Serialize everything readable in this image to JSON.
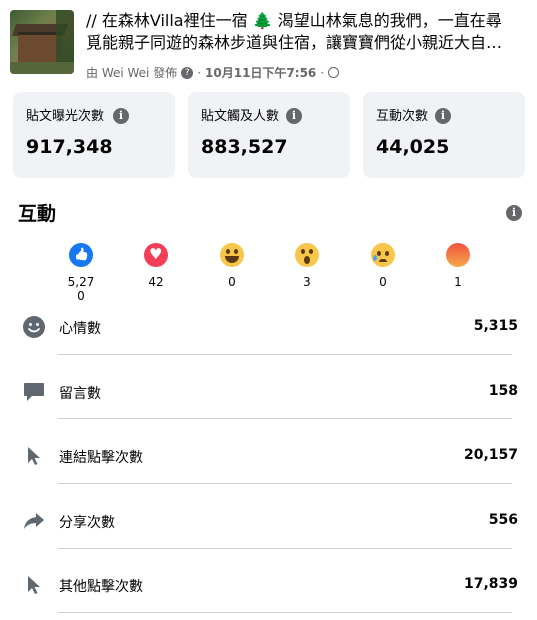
{
  "post": {
    "line1": "// 在森林Villa裡住一宿 🌲 渴望山林氣息的我們，一直在尋",
    "line2": "覓能親子同遊的森林步道與住宿，讓寶寶們從小親近大自…",
    "author_prefix": "由 Wei Wei 發佈",
    "date": "10月11日下午7:56",
    "separator": "·"
  },
  "stats": [
    {
      "label": "貼文曝光次數",
      "value": "917,348"
    },
    {
      "label": "貼文觸及人數",
      "value": "883,527"
    },
    {
      "label": "互動次數",
      "value": "44,025"
    }
  ],
  "engagement": {
    "title": "互動",
    "reactions": [
      {
        "icon": "like-icon",
        "count": "5,270"
      },
      {
        "icon": "love-icon",
        "count": "42"
      },
      {
        "icon": "haha-icon",
        "count": "0"
      },
      {
        "icon": "wow-icon",
        "count": "3"
      },
      {
        "icon": "sad-icon",
        "count": "0"
      },
      {
        "icon": "angry-icon",
        "count": "1"
      }
    ],
    "rows": [
      {
        "icon": "smiley-icon",
        "label": "心情數",
        "value": "5,315"
      },
      {
        "icon": "comment-icon",
        "label": "留言數",
        "value": "158"
      },
      {
        "icon": "cursor-icon",
        "label": "連結點擊次數",
        "value": "20,157"
      },
      {
        "icon": "share-icon",
        "label": "分享次數",
        "value": "556"
      },
      {
        "icon": "cursor-icon",
        "label": "其他點擊次數",
        "value": "17,839"
      }
    ]
  },
  "colors": {
    "card_bg": "#f0f2f5",
    "icon_gray": "#606770",
    "like_blue": "#1877f2",
    "love_red": "#f33e58"
  }
}
